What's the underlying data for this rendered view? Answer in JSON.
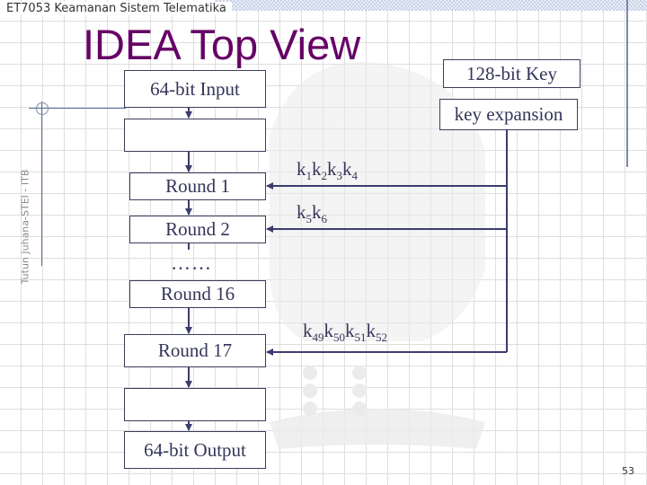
{
  "header": {
    "course_title": "ET7053 Keamanan Sistem Telematika",
    "side_credit": "Tutun Juhana-STEI - ITB",
    "page_number": "53"
  },
  "slide": {
    "title": "IDEA Top View"
  },
  "diagram": {
    "data_path": {
      "input_label": "64-bit Input",
      "rounds": [
        {
          "label": "Round 1"
        },
        {
          "label": "Round 2"
        },
        {
          "label": "Round 16"
        },
        {
          "label": "Round 17"
        }
      ],
      "ellipsis": "……",
      "output_label": "64-bit Output"
    },
    "key_path": {
      "key_label": "128-bit Key",
      "expansion_label": "key expansion",
      "subkeys": [
        {
          "round": "Round 1",
          "keys": [
            {
              "b": "k",
              "s": "1"
            },
            {
              "b": "k",
              "s": "2"
            },
            {
              "b": "k",
              "s": "3"
            },
            {
              "b": "k",
              "s": "4"
            }
          ]
        },
        {
          "round": "Round 2",
          "keys": [
            {
              "b": "k",
              "s": "5"
            },
            {
              "b": "k",
              "s": "6"
            }
          ]
        },
        {
          "round": "Round 17",
          "keys": [
            {
              "b": "k",
              "s": "49"
            },
            {
              "b": "k",
              "s": "50"
            },
            {
              "b": "k",
              "s": "51"
            },
            {
              "b": "k",
              "s": "52"
            }
          ]
        }
      ]
    }
  },
  "colors": {
    "title": "#660066",
    "box_border": "#3c3c5e",
    "line": "#3c3c6e",
    "text": "#35355a"
  }
}
